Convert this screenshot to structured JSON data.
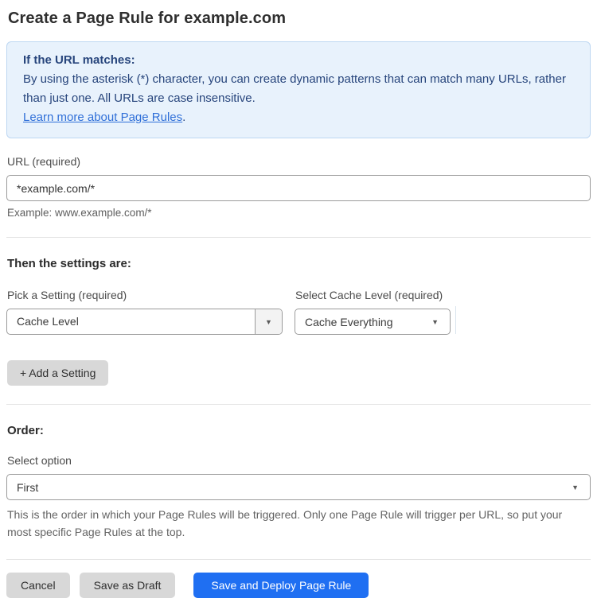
{
  "page": {
    "title": "Create a Page Rule for example.com"
  },
  "info_box": {
    "heading": "If the URL matches:",
    "body": "By using the asterisk (*) character, you can create dynamic patterns that can match many URLs, rather than just one. All URLs are case insensitive.",
    "link_label": "Learn more about Page Rules",
    "link_suffix": "."
  },
  "url_field": {
    "label": "URL (required)",
    "value": "*example.com/*",
    "helper": "Example: www.example.com/*"
  },
  "settings_section": {
    "heading": "Then the settings are:",
    "setting_picker": {
      "label": "Pick a Setting (required)",
      "selected": "Cache Level"
    },
    "cache_level_picker": {
      "label": "Select Cache Level (required)",
      "selected": "Cache Everything"
    },
    "add_setting_label": "+ Add a Setting"
  },
  "order_section": {
    "heading": "Order:",
    "select_label": "Select option",
    "selected": "First",
    "helper": "This is the order in which your Page Rules will be triggered. Only one Page Rule will trigger per URL, so put your most specific Page Rules at the top."
  },
  "footer": {
    "cancel_label": "Cancel",
    "save_draft_label": "Save as Draft",
    "save_deploy_label": "Save and Deploy Page Rule"
  },
  "icons": {
    "dropdown_arrow": "▼"
  },
  "colors": {
    "accent_blue": "#1f6ff2",
    "info_bg": "#e8f2fc",
    "info_border": "#bdd7f2",
    "info_text": "#27457c",
    "link_blue": "#2f6fd8"
  }
}
